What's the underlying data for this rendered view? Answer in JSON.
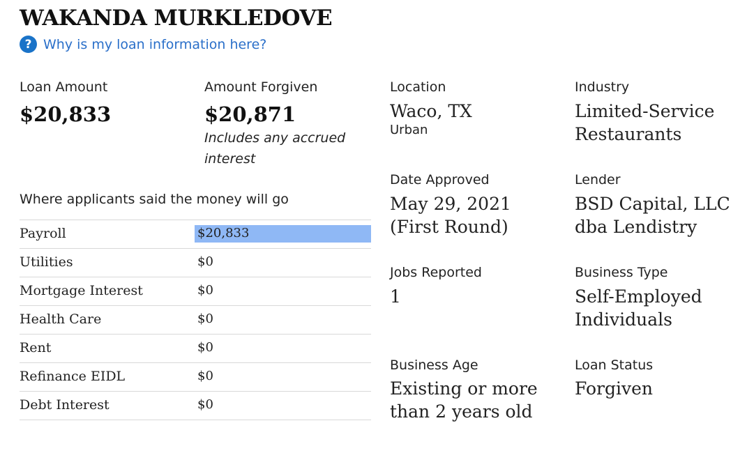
{
  "header": {
    "title": "WAKANDA MURKLEDOVE",
    "help_link": "Why is my loan information here?"
  },
  "loan_amount": {
    "label": "Loan Amount",
    "value": "$20,833"
  },
  "amount_forgiven": {
    "label": "Amount Forgiven",
    "value": "$20,871",
    "note": "Includes any accrued interest"
  },
  "location": {
    "label": "Location",
    "value": "Waco, TX",
    "sub": "Urban"
  },
  "industry": {
    "label": "Industry",
    "value": "Limited-Service Restaurants"
  },
  "date_approved": {
    "label": "Date Approved",
    "value": "May 29, 2021 (First Round)"
  },
  "lender": {
    "label": "Lender",
    "value": "BSD Capital, LLC dba Lendistry"
  },
  "jobs_reported": {
    "label": "Jobs Reported",
    "value": "1"
  },
  "business_type": {
    "label": "Business Type",
    "value": "Self-Employed Individuals"
  },
  "business_age": {
    "label": "Business Age",
    "value": "Existing or more than 2 years old"
  },
  "loan_status": {
    "label": "Loan Status",
    "value": "Forgiven"
  },
  "uses": {
    "heading": "Where applicants said the money will go",
    "rows": [
      {
        "category": "Payroll",
        "amount": "$20,833",
        "fraction": 1.0
      },
      {
        "category": "Utilities",
        "amount": "$0",
        "fraction": 0
      },
      {
        "category": "Mortgage Interest",
        "amount": "$0",
        "fraction": 0
      },
      {
        "category": "Health Care",
        "amount": "$0",
        "fraction": 0
      },
      {
        "category": "Rent",
        "amount": "$0",
        "fraction": 0
      },
      {
        "category": "Refinance EIDL",
        "amount": "$0",
        "fraction": 0
      },
      {
        "category": "Debt Interest",
        "amount": "$0",
        "fraction": 0
      }
    ]
  },
  "colors": {
    "bar": "#8fb8f5",
    "link": "#2a6fc9",
    "help_icon_bg": "#1a73c8"
  }
}
